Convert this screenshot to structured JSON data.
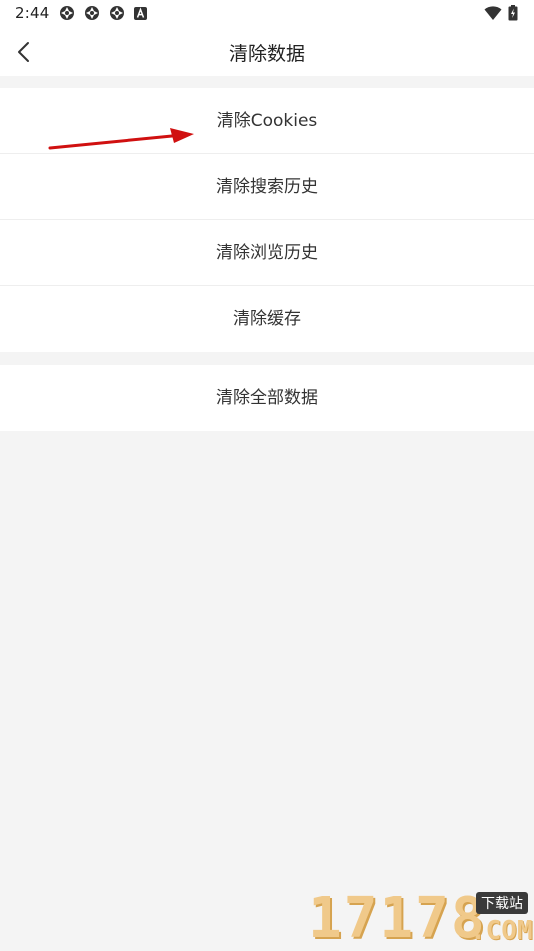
{
  "status_bar": {
    "time": "2:44",
    "left_icons": [
      "app-notification-icon",
      "app-notification-icon",
      "app-notification-icon",
      "a-badge-icon"
    ],
    "right_icons": [
      "wifi-icon",
      "battery-icon"
    ]
  },
  "header": {
    "back_icon": "chevron-left-icon",
    "title": "清除数据"
  },
  "menu_group_1": {
    "items": [
      {
        "label": "清除Cookies"
      },
      {
        "label": "清除搜索历史"
      },
      {
        "label": "清除浏览历史"
      },
      {
        "label": "清除缓存"
      }
    ]
  },
  "menu_group_2": {
    "items": [
      {
        "label": "清除全部数据"
      }
    ]
  },
  "annotation": {
    "arrow_color": "#d01010"
  },
  "watermark": {
    "digits": "17178",
    "badge": "下载站",
    "com": ".COM"
  },
  "colors": {
    "page_background": "#f4f4f4",
    "surface": "#ffffff",
    "text": "#333333",
    "divider": "#eeeeee"
  }
}
